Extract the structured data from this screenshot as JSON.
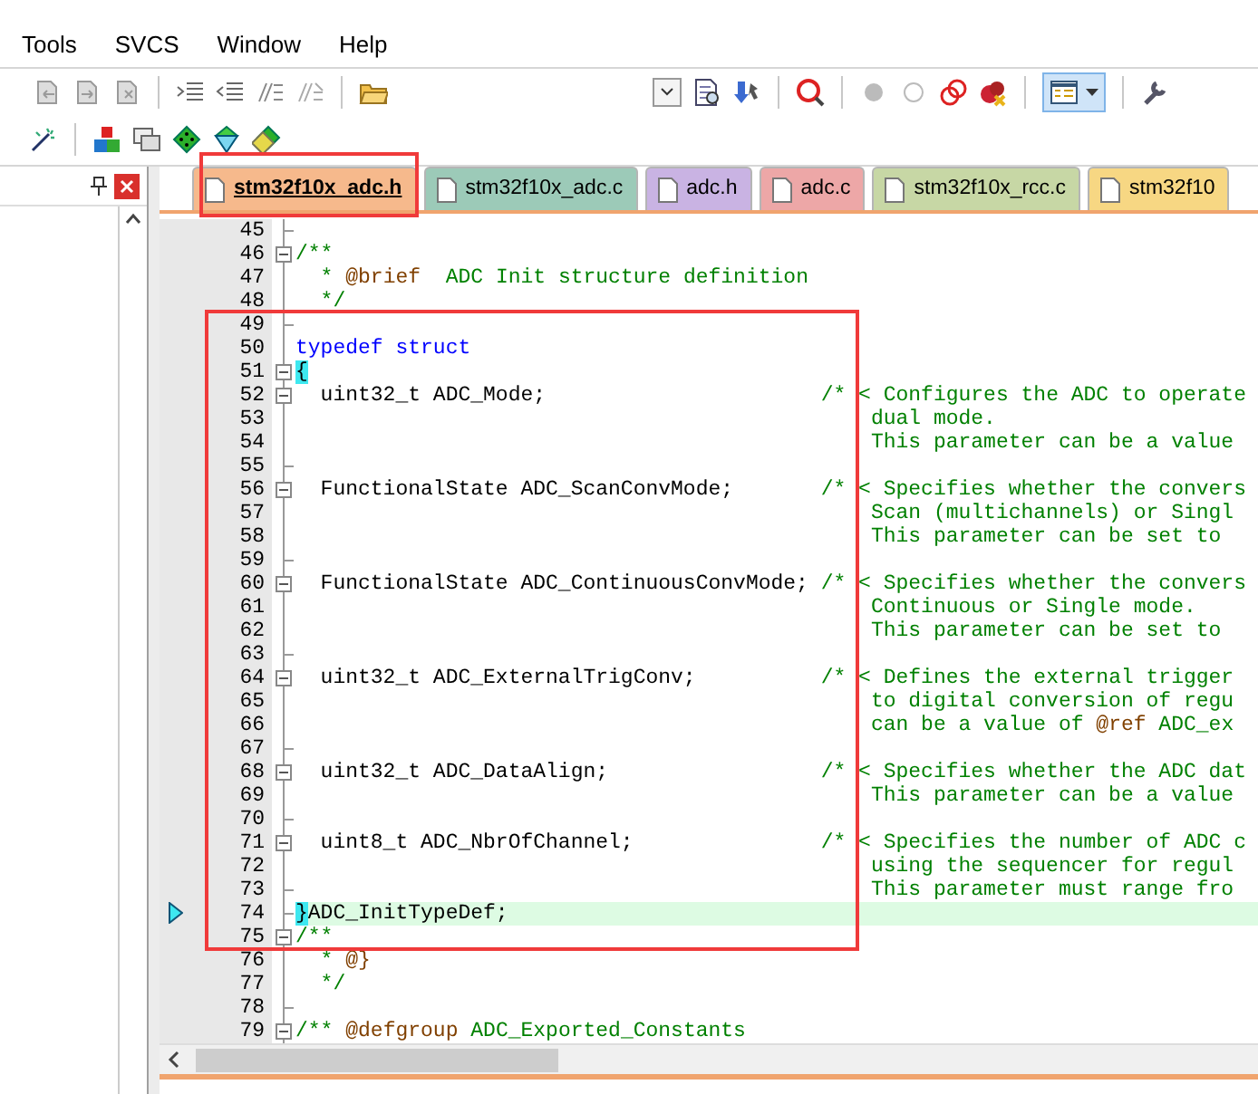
{
  "menu": [
    "Tools",
    "SVCS",
    "Window",
    "Help"
  ],
  "tabs": [
    {
      "label": "stm32f10x_adc.h",
      "selected": true,
      "color": "#f6b98c"
    },
    {
      "label": "stm32f10x_adc.c",
      "selected": false,
      "color": "#9ccab8"
    },
    {
      "label": "adc.h",
      "selected": false,
      "color": "#c9b3e3"
    },
    {
      "label": "adc.c",
      "selected": false,
      "color": "#eda7a7"
    },
    {
      "label": "stm32f10x_rcc.c",
      "selected": false,
      "color": "#c7d7a5"
    },
    {
      "label": "stm32f10",
      "selected": false,
      "color": "#f7d783"
    }
  ],
  "code_lines": [
    {
      "number": "45",
      "kind": "fold-end",
      "current": false
    },
    {
      "number": "46",
      "kind": "fold-start",
      "current": false,
      "segments": [
        {
          "kind": "comment",
          "text": "/**"
        }
      ]
    },
    {
      "number": "47",
      "kind": "plain",
      "current": false,
      "segments": [
        {
          "kind": "comment",
          "text": "  * "
        },
        {
          "kind": "doctag",
          "text": "@brief"
        },
        {
          "kind": "comment",
          "text": "  ADC Init structure definition"
        }
      ]
    },
    {
      "number": "48",
      "kind": "plain",
      "current": false,
      "segments": [
        {
          "kind": "comment",
          "text": "  */"
        }
      ]
    },
    {
      "number": "49",
      "kind": "fold-end",
      "current": false
    },
    {
      "number": "50",
      "kind": "plain",
      "current": false,
      "segments": [
        {
          "kind": "keyword",
          "text": "typedef struct"
        }
      ]
    },
    {
      "number": "51",
      "kind": "fold-start",
      "current": false,
      "segments": [
        {
          "kind": "brace",
          "text": "{"
        }
      ]
    },
    {
      "number": "52",
      "kind": "fold-start",
      "current": false,
      "segments": [
        {
          "kind": "decl",
          "text": "  uint32_t ADC_Mode;"
        },
        {
          "kind": "comment",
          "text": "/* < Configures the ADC to operate"
        }
      ]
    },
    {
      "number": "53",
      "kind": "plain",
      "current": false,
      "segments": [
        {
          "kind": "cont",
          "text": "dual mode."
        }
      ]
    },
    {
      "number": "54",
      "kind": "plain",
      "current": false,
      "segments": [
        {
          "kind": "cont",
          "text": "This parameter can be a value"
        }
      ]
    },
    {
      "number": "55",
      "kind": "fold-end",
      "current": false
    },
    {
      "number": "56",
      "kind": "fold-start",
      "current": false,
      "segments": [
        {
          "kind": "decl",
          "text": "  FunctionalState ADC_ScanConvMode;"
        },
        {
          "kind": "comment",
          "text": "/* < Specifies whether the convers"
        }
      ]
    },
    {
      "number": "57",
      "kind": "plain",
      "current": false,
      "segments": [
        {
          "kind": "cont",
          "text": "Scan (multichannels) or Singl"
        }
      ]
    },
    {
      "number": "58",
      "kind": "plain",
      "current": false,
      "segments": [
        {
          "kind": "cont",
          "text": "This parameter can be set to"
        }
      ]
    },
    {
      "number": "59",
      "kind": "fold-end",
      "current": false
    },
    {
      "number": "60",
      "kind": "fold-start",
      "current": false,
      "segments": [
        {
          "kind": "decl",
          "text": "  FunctionalState ADC_ContinuousConvMode;"
        },
        {
          "kind": "comment",
          "text": "/* < Specifies whether the convers"
        }
      ]
    },
    {
      "number": "61",
      "kind": "plain",
      "current": false,
      "segments": [
        {
          "kind": "cont",
          "text": "Continuous or Single mode."
        }
      ]
    },
    {
      "number": "62",
      "kind": "plain",
      "current": false,
      "segments": [
        {
          "kind": "cont",
          "text": "This parameter can be set to"
        }
      ]
    },
    {
      "number": "63",
      "kind": "fold-end",
      "current": false
    },
    {
      "number": "64",
      "kind": "fold-start",
      "current": false,
      "segments": [
        {
          "kind": "decl",
          "text": "  uint32_t ADC_ExternalTrigConv;"
        },
        {
          "kind": "comment",
          "text": "/* < Defines the external trigger"
        }
      ]
    },
    {
      "number": "65",
      "kind": "plain",
      "current": false,
      "segments": [
        {
          "kind": "cont",
          "text": "to digital conversion of regu"
        }
      ]
    },
    {
      "number": "66",
      "kind": "plain",
      "current": false,
      "segments": [
        {
          "kind": "cont",
          "text": "can be a value of "
        },
        {
          "kind": "doctag",
          "text": "@ref"
        },
        {
          "kind": "comment",
          "text": " ADC_ex"
        }
      ]
    },
    {
      "number": "67",
      "kind": "fold-end",
      "current": false
    },
    {
      "number": "68",
      "kind": "fold-start",
      "current": false,
      "segments": [
        {
          "kind": "decl",
          "text": "  uint32_t ADC_DataAlign;"
        },
        {
          "kind": "comment",
          "text": "/* < Specifies whether the ADC dat"
        }
      ]
    },
    {
      "number": "69",
      "kind": "plain",
      "current": false,
      "segments": [
        {
          "kind": "cont",
          "text": "This parameter can be a value"
        }
      ]
    },
    {
      "number": "70",
      "kind": "fold-end",
      "current": false
    },
    {
      "number": "71",
      "kind": "fold-start",
      "current": false,
      "segments": [
        {
          "kind": "decl",
          "text": "  uint8_t ADC_NbrOfChannel;"
        },
        {
          "kind": "comment",
          "text": "/* < Specifies the number of ADC c"
        }
      ]
    },
    {
      "number": "72",
      "kind": "plain",
      "current": false,
      "segments": [
        {
          "kind": "cont",
          "text": "using the sequencer for regul"
        }
      ]
    },
    {
      "number": "73",
      "kind": "fold-end",
      "current": false,
      "segments": [
        {
          "kind": "cont",
          "text": "This parameter must range fro"
        }
      ]
    },
    {
      "number": "74",
      "kind": "fold-end",
      "current": true,
      "segments": [
        {
          "kind": "brace",
          "text": "}"
        },
        {
          "kind": "code",
          "text": "ADC_InitTypeDef;"
        }
      ]
    },
    {
      "number": "75",
      "kind": "fold-start",
      "current": false,
      "segments": [
        {
          "kind": "comment",
          "text": "/**"
        }
      ]
    },
    {
      "number": "76",
      "kind": "plain",
      "current": false,
      "segments": [
        {
          "kind": "comment",
          "text": "  * "
        },
        {
          "kind": "doctag",
          "text": "@}"
        }
      ]
    },
    {
      "number": "77",
      "kind": "plain",
      "current": false,
      "segments": [
        {
          "kind": "comment",
          "text": "  */"
        }
      ]
    },
    {
      "number": "78",
      "kind": "fold-end",
      "current": false
    },
    {
      "number": "79",
      "kind": "fold-start",
      "current": false,
      "segments": [
        {
          "kind": "comment",
          "text": "/** "
        },
        {
          "kind": "doctag",
          "text": "@defgroup"
        },
        {
          "kind": "comment",
          "text": " ADC_Exported_Constants"
        }
      ]
    }
  ]
}
